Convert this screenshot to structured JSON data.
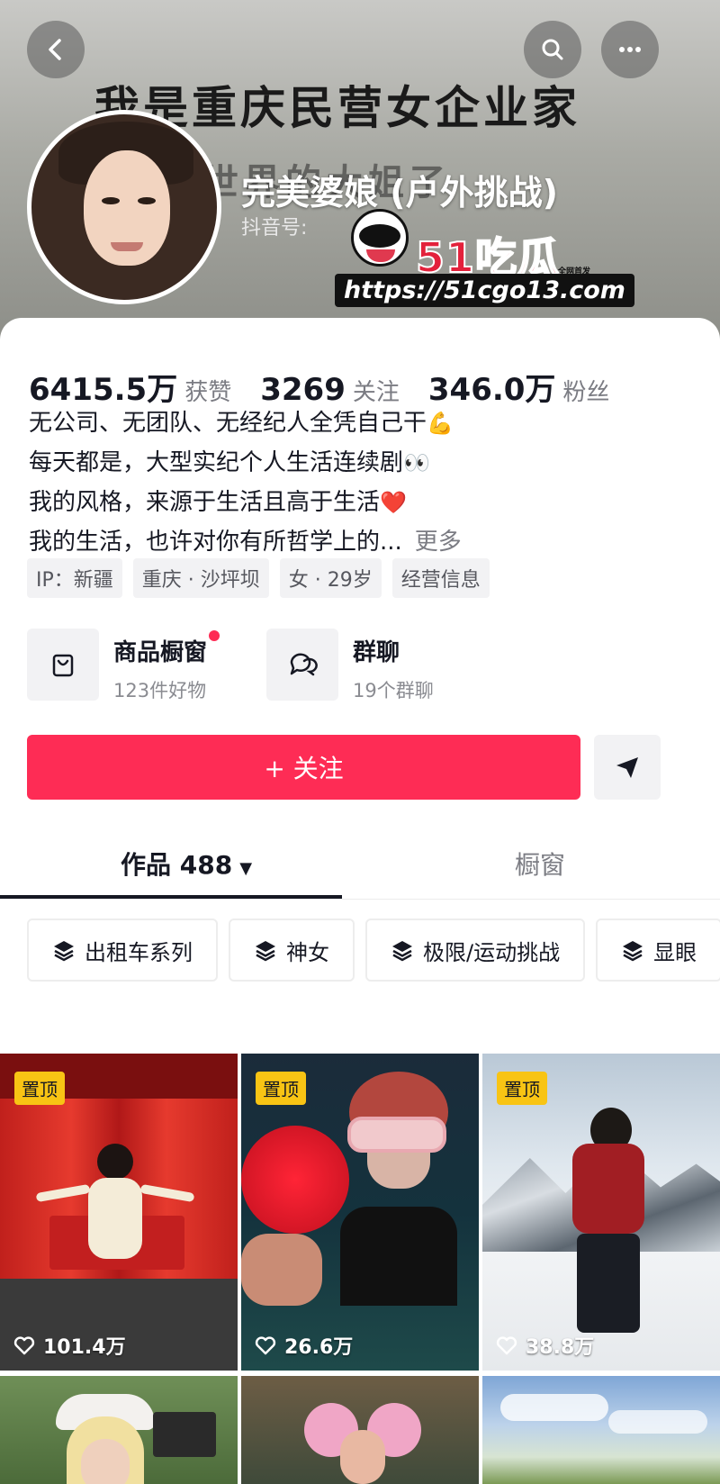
{
  "header": {
    "banner_line1": "我是重庆民营女企业家",
    "banner_line2": "世界的大姐了",
    "nickname": "完美婆娘 (户外挑战)",
    "douyin_id_label": "抖音号:",
    "watermark_brand": "51吃瓜",
    "watermark_small": "全网首发",
    "watermark_url": "https://51cgo13.com"
  },
  "stats": [
    {
      "value": "6415.5万",
      "label": "获赞"
    },
    {
      "value": "3269",
      "label": "关注"
    },
    {
      "value": "346.0万",
      "label": "粉丝"
    }
  ],
  "bio": {
    "line1": "无公司、无团队、无经纪人全凭自己干",
    "line2": "每天都是，大型实纪个人生活连续剧",
    "line3": "我的风格，来源于生活且高于生活",
    "line4": "我的生活，也许对你有所哲学上的...",
    "more": "更多",
    "emoji1": "💪",
    "emoji2": "👀",
    "emoji3": "❤️"
  },
  "tags": [
    "IP：新疆",
    "重庆 · 沙坪坝",
    "女 · 29岁",
    "经营信息"
  ],
  "features": [
    {
      "title": "商品橱窗",
      "sub": "123件好物"
    },
    {
      "title": "群聊",
      "sub": "19个群聊"
    }
  ],
  "follow_label": "+ 关注",
  "tabs": {
    "works": "作品 488",
    "caret": "▼",
    "window": "橱窗"
  },
  "chips": [
    "出租车系列",
    "神女",
    "极限/运动挑战",
    "显眼"
  ],
  "videos": [
    {
      "pin": "置顶",
      "likes": "101.4万"
    },
    {
      "pin": "置顶",
      "likes": "26.6万"
    },
    {
      "pin": "置顶",
      "likes": "38.8万"
    }
  ],
  "colors": {
    "accent": "#fe2c55",
    "pin": "#f8c414",
    "text": "#161823",
    "muted": "#7b7c83"
  }
}
